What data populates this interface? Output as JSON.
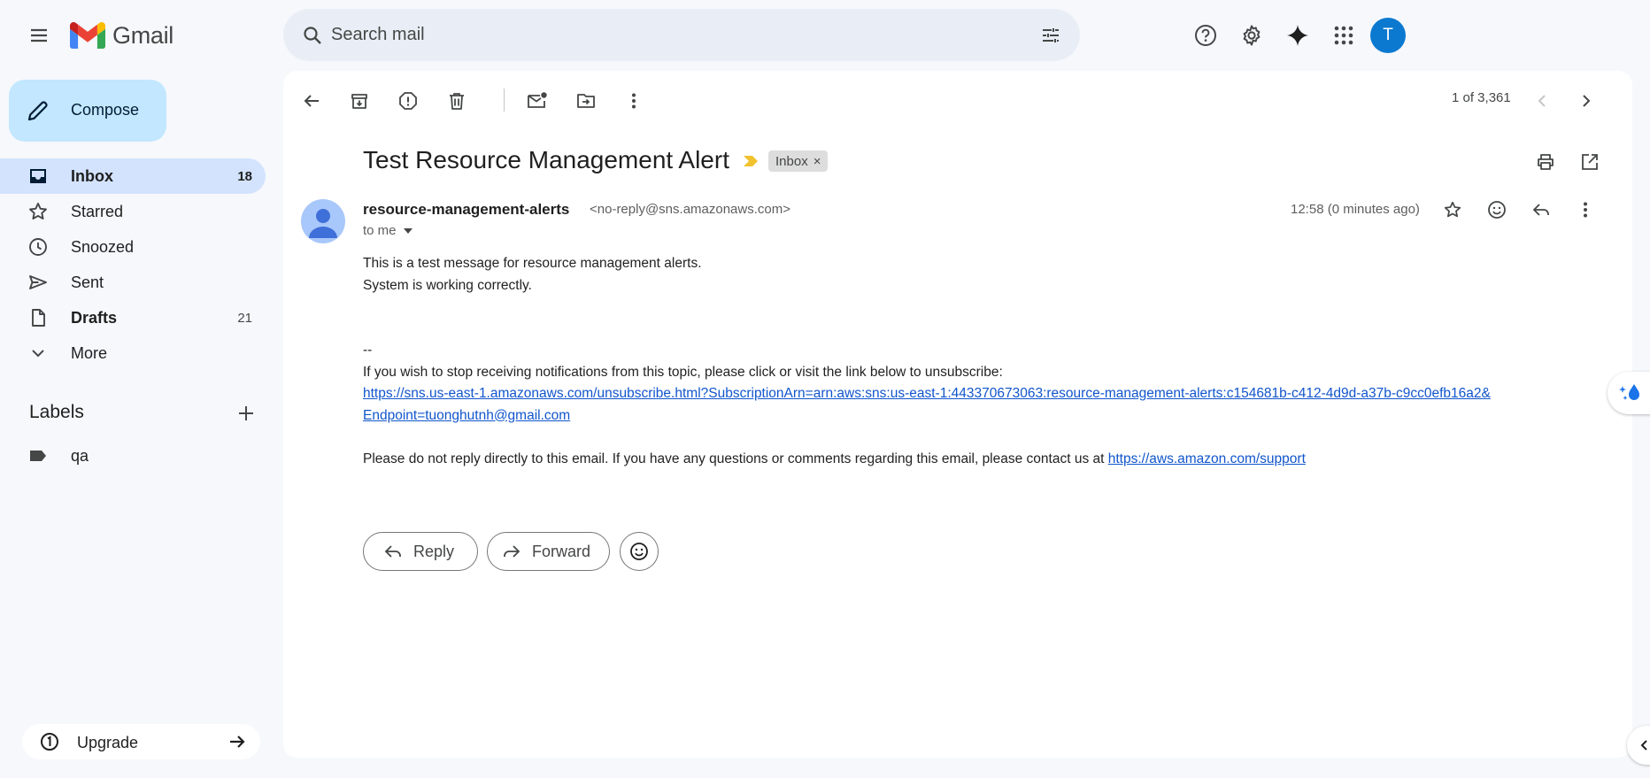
{
  "app": {
    "brand": "Gmail"
  },
  "search": {
    "placeholder": "Search mail"
  },
  "compose": {
    "label": "Compose"
  },
  "nav": [
    {
      "label": "Inbox",
      "count": "18",
      "icon": "inbox-icon"
    },
    {
      "label": "Starred",
      "count": "",
      "icon": "star-icon"
    },
    {
      "label": "Snoozed",
      "count": "",
      "icon": "clock-icon"
    },
    {
      "label": "Sent",
      "count": "",
      "icon": "send-icon"
    },
    {
      "label": "Drafts",
      "count": "21",
      "icon": "draft-icon"
    },
    {
      "label": "More",
      "count": "",
      "icon": "chevron-down-icon"
    }
  ],
  "labels": {
    "title": "Labels",
    "items": [
      {
        "label": "qa",
        "icon": "label-icon"
      }
    ]
  },
  "upgrade": {
    "label": "Upgrade"
  },
  "account": {
    "initial": "T",
    "color": "#0b79d0"
  },
  "pager": {
    "text": "1 of 3,361"
  },
  "email": {
    "subject": "Test Resource Management Alert",
    "chip": "Inbox",
    "chip_close": "×",
    "sender_name": "resource-management-alerts",
    "sender_email": "<no-reply@sns.amazonaws.com>",
    "to": "to me",
    "time": "12:58 (0 minutes ago)",
    "body": {
      "line1": "This is a test message for resource management alerts.",
      "line2": "System is working correctly.",
      "sig": "--",
      "unsub_text": "If you wish to stop receiving notifications from this topic, please click or visit the link below to unsubscribe:",
      "unsub_link_1": "https://sns.us-east-1.amazonaws.com/unsubscribe.html?SubscriptionArn=arn:aws:sns:us-east-1:443370673063:resource-management-alerts:c154681b-c412-4d9d-a37b-c9cc0efb16a2&",
      "unsub_link_2": "Endpoint=tuonghutnh@gmail.com",
      "support_text": "Please do not reply directly to this email. If you have any questions or comments regarding this email, please contact us at ",
      "support_link": "https://aws.amazon.com/support"
    }
  },
  "actions": {
    "reply": "Reply",
    "forward": "Forward"
  },
  "colors": {
    "accent": "#0b57d0",
    "compose_bg": "#c2e7ff",
    "active_nav": "#d3e3fd",
    "link": "#1155cc",
    "importance": "#f2c12e"
  }
}
